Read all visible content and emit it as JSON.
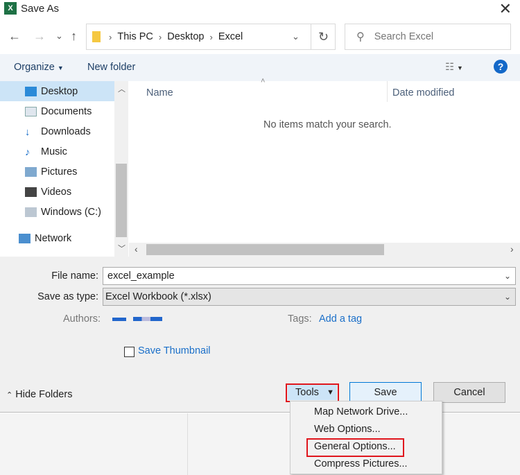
{
  "window": {
    "title": "Save As",
    "close": "✕"
  },
  "nav": {
    "back": "←",
    "forward": "→",
    "recent": "⌄",
    "up": "↑",
    "breadcrumbs": [
      "This PC",
      "Desktop",
      "Excel"
    ],
    "refresh": "↻",
    "search_placeholder": "Search Excel"
  },
  "toolbar": {
    "organize": "Organize",
    "new_folder": "New folder",
    "help": "?"
  },
  "sidebar": {
    "items": [
      {
        "label": "Desktop",
        "icon": "desktop-icon",
        "selected": true
      },
      {
        "label": "Documents",
        "icon": "documents-icon"
      },
      {
        "label": "Downloads",
        "icon": "downloads-icon"
      },
      {
        "label": "Music",
        "icon": "music-icon"
      },
      {
        "label": "Pictures",
        "icon": "pictures-icon"
      },
      {
        "label": "Videos",
        "icon": "videos-icon"
      },
      {
        "label": "Windows (C:)",
        "icon": "drive-icon"
      },
      {
        "label": "Network",
        "icon": "network-icon"
      }
    ]
  },
  "files": {
    "columns": [
      "Name",
      "Date modified"
    ],
    "empty_message": "No items match your search."
  },
  "form": {
    "file_name_label": "File name:",
    "file_name": "excel_example",
    "type_label": "Save as type:",
    "type": "Excel Workbook (*.xlsx)",
    "authors_label": "Authors:",
    "tags_label": "Tags:",
    "tags_value": "Add a tag",
    "thumbnail_label": "Save Thumbnail"
  },
  "footer": {
    "hide_folders": "Hide Folders",
    "tools": "Tools",
    "save": "Save",
    "cancel": "Cancel"
  },
  "tools_menu": {
    "items": [
      "Map Network Drive...",
      "Web Options...",
      "General Options...",
      "Compress Pictures..."
    ],
    "highlighted": "General Options..."
  },
  "colors": {
    "accent": "#1468c8",
    "highlight": "#e0161d",
    "selected": "#cce4f7"
  }
}
